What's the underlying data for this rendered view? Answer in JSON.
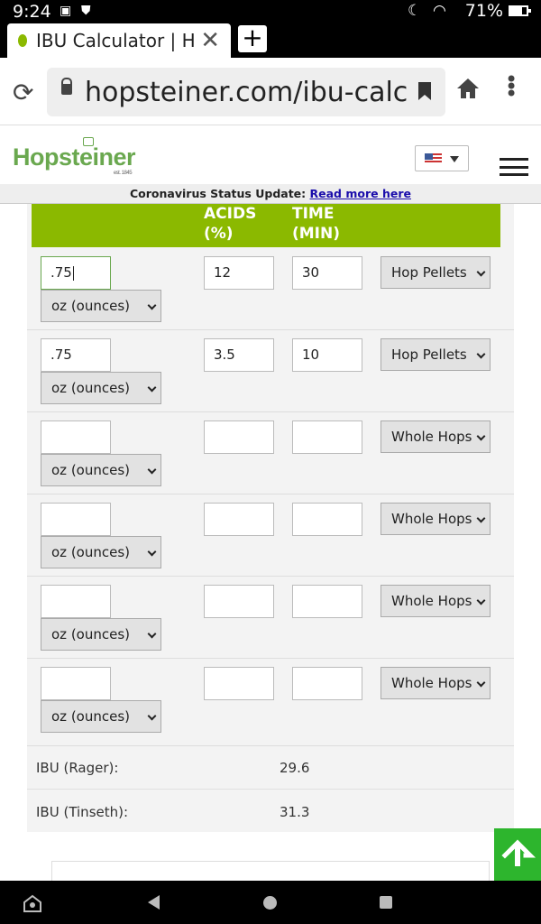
{
  "status_bar": {
    "time": "9:24",
    "battery": "71%"
  },
  "browser": {
    "tab_title": "IBU Calculator | Hopsteiner",
    "url": "hopsteiner.com/ibu-calculator"
  },
  "site": {
    "logo": "Hopsteiner",
    "logo_sub": "est. 1845",
    "notice_text": "Coronavirus Status Update:",
    "notice_link": "Read more here"
  },
  "table": {
    "headers": {
      "acids": "ACIDS",
      "acids_unit": "(%)",
      "time": "TIME",
      "time_unit": "(MIN)"
    },
    "rows": [
      {
        "amount": ".75",
        "unit": "oz (ounces)",
        "acids": "12",
        "time": "30",
        "form": "Hop Pellets"
      },
      {
        "amount": ".75",
        "unit": "oz (ounces)",
        "acids": "3.5",
        "time": "10",
        "form": "Hop Pellets"
      },
      {
        "amount": "",
        "unit": "oz (ounces)",
        "acids": "",
        "time": "",
        "form": "Whole Hops"
      },
      {
        "amount": "",
        "unit": "oz (ounces)",
        "acids": "",
        "time": "",
        "form": "Whole Hops"
      },
      {
        "amount": "",
        "unit": "oz (ounces)",
        "acids": "",
        "time": "",
        "form": "Whole Hops"
      },
      {
        "amount": "",
        "unit": "oz (ounces)",
        "acids": "",
        "time": "",
        "form": "Whole Hops"
      }
    ]
  },
  "results": [
    {
      "label": "IBU (Rager):",
      "value": "29.6"
    },
    {
      "label": "IBU (Tinseth):",
      "value": "31.3"
    }
  ],
  "colors": {
    "accent": "#8bb900",
    "scroll_button": "#2db52d"
  }
}
